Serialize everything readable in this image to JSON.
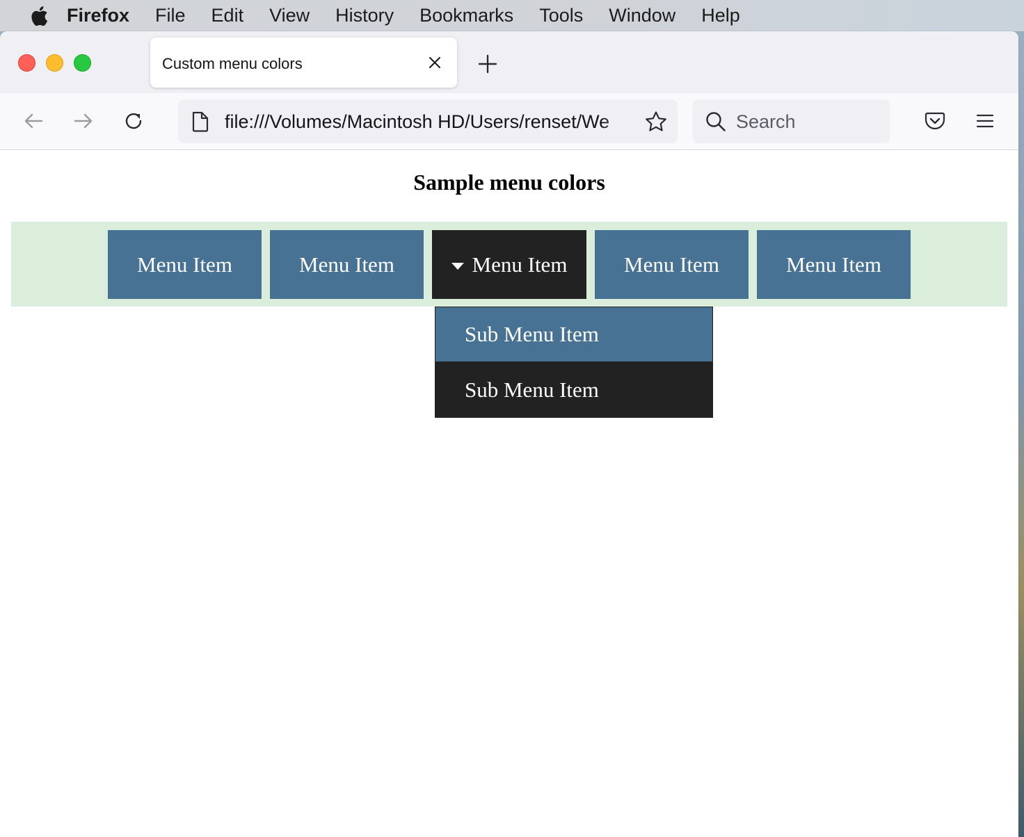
{
  "menubar": {
    "app_name": "Firefox",
    "items": [
      "File",
      "Edit",
      "View",
      "History",
      "Bookmarks",
      "Tools",
      "Window",
      "Help"
    ]
  },
  "browser": {
    "tab_title": "Custom menu colors",
    "url": "file:///Volumes/Macintosh HD/Users/renset/We",
    "search_placeholder": "Search"
  },
  "page": {
    "title": "Sample menu colors",
    "menu_items": [
      "Menu Item",
      "Menu Item",
      "Menu Item",
      "Menu Item",
      "Menu Item"
    ],
    "active_index": 2,
    "submenu_items": [
      "Sub Menu Item",
      "Sub Menu Item"
    ]
  },
  "colors": {
    "menu_item_bg": "#477294",
    "menu_active_bg": "#222222",
    "menu_strip_bg": "#dbeedb",
    "submenu_highlight": "#477294",
    "submenu_bg": "#222222"
  }
}
